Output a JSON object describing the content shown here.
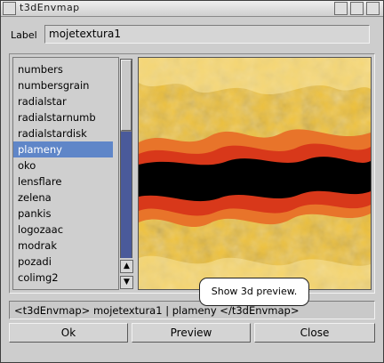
{
  "window": {
    "title": "t3dEnvmap"
  },
  "label_row": {
    "label": "Label",
    "value": "mojetextura1"
  },
  "list": {
    "items": [
      "numbers",
      "numbersgrain",
      "radialstar",
      "radialstarnumb",
      "radialstardisk",
      "plameny",
      "oko",
      "lensflare",
      "zelena",
      "pankis",
      "logozaac",
      "modrak",
      "pozadi",
      "colimg2"
    ],
    "selected_index": 5
  },
  "scrollbar": {
    "up_icon": "arrow-up-icon",
    "down_icon": "arrow-down-icon"
  },
  "status_text": "<t3dEnvmap> mojetextura1 | plameny </t3dEnvmap>",
  "buttons": {
    "ok": "Ok",
    "preview": "Preview",
    "close": "Close"
  },
  "tooltip": "Show 3d preview.",
  "colors": {
    "selection": "#5f86c8",
    "flame_dark": "#000000",
    "flame_red": "#e0401a",
    "flame_yellow": "#f0c23a"
  }
}
